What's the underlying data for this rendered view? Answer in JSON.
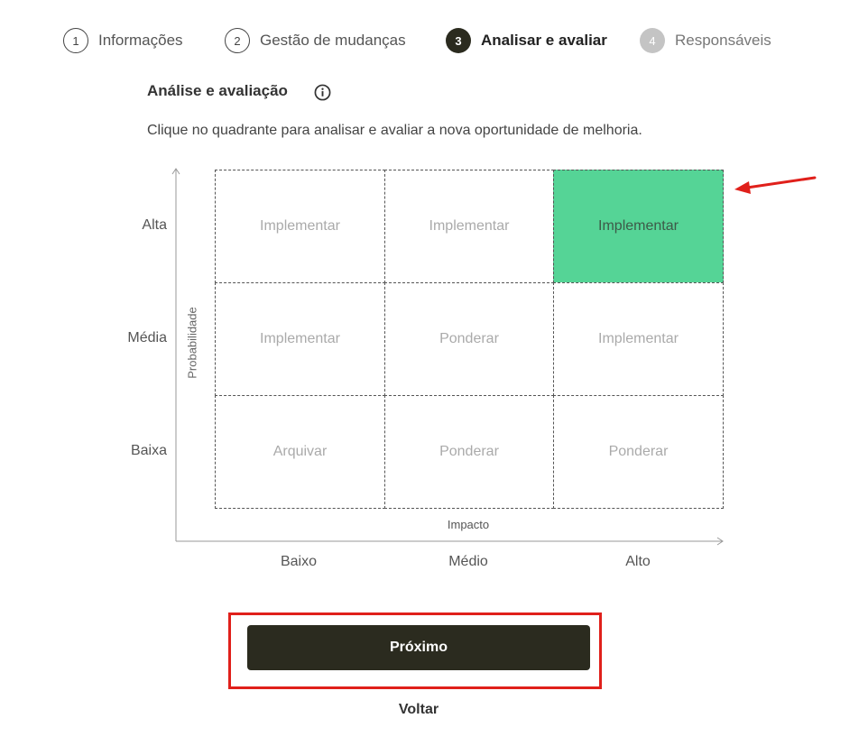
{
  "stepper": {
    "steps": [
      {
        "number": "1",
        "label": "Informações",
        "state": "completed"
      },
      {
        "number": "2",
        "label": "Gestão de mudanças",
        "state": "completed"
      },
      {
        "number": "3",
        "label": "Analisar e avaliar",
        "state": "active"
      },
      {
        "number": "4",
        "label": "Responsáveis",
        "state": "disabled"
      }
    ]
  },
  "section": {
    "title": "Análise e avaliação",
    "info_icon": "info-circle-icon",
    "description": "Clique no quadrante para analisar e avaliar a nova oportunidade de melhoria."
  },
  "matrix": {
    "y_axis_title": "Probabilidade",
    "x_axis_title": "Impacto",
    "row_labels": [
      "Alta",
      "Média",
      "Baixa"
    ],
    "column_labels": [
      "Baixo",
      "Médio",
      "Alto"
    ],
    "cells": [
      [
        "Implementar",
        "Implementar",
        "Implementar"
      ],
      [
        "Implementar",
        "Ponderar",
        "Implementar"
      ],
      [
        "Arquivar",
        "Ponderar",
        "Ponderar"
      ]
    ],
    "selected": {
      "row": "Alta",
      "column": "Alto"
    },
    "selected_color": "#55d496"
  },
  "actions": {
    "next_label": "Próximo",
    "back_label": "Voltar"
  },
  "colors": {
    "primary": "#2b2b1f",
    "annotation": "#e0201b"
  }
}
